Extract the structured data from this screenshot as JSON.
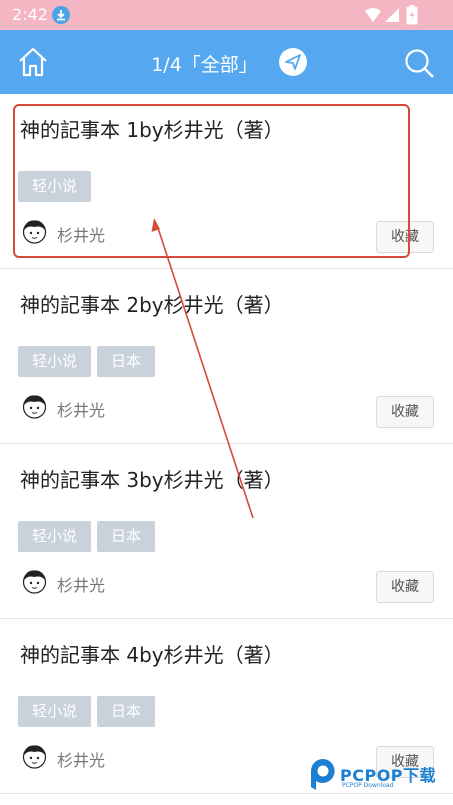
{
  "status_bar": {
    "time": "2:42"
  },
  "toolbar": {
    "title": "1/4「全部」"
  },
  "books": [
    {
      "name": "神的記事本 1by杉井光（著）",
      "tags": [
        "轻小说"
      ],
      "author": "杉井光",
      "fav_label": "收藏"
    },
    {
      "name": "神的記事本 2by杉井光（著）",
      "tags": [
        "轻小说",
        "日本"
      ],
      "author": "杉井光",
      "fav_label": "收藏"
    },
    {
      "name": "神的記事本 3by杉井光（著）",
      "tags": [
        "轻小说",
        "日本"
      ],
      "author": "杉井光",
      "fav_label": "收藏"
    },
    {
      "name": "神的記事本 4by杉井光（著）",
      "tags": [
        "轻小说",
        "日本"
      ],
      "author": "杉井光",
      "fav_label": "收藏"
    }
  ],
  "watermark": {
    "brand": "PCPOP下载",
    "tagline": "PCPOP Download"
  },
  "colors": {
    "toolbar": "#55a8f0",
    "status_bar": "#f4b6c2",
    "tag": "#c9d2db",
    "annotation": "#d54a3b"
  }
}
